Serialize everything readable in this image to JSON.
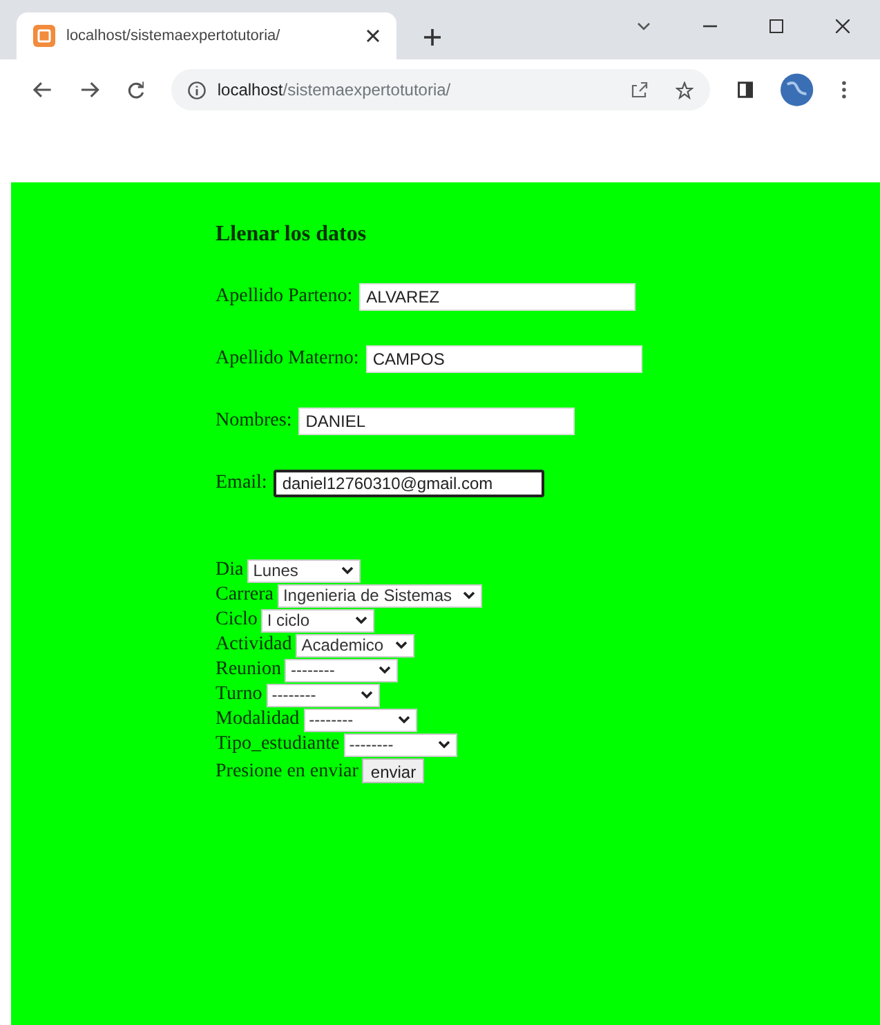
{
  "browser": {
    "tab": {
      "title": "localhost/sistemaexpertotutoria/"
    },
    "address": {
      "host": "localhost",
      "path": "/sistemaexpertotutoria/"
    }
  },
  "form": {
    "heading": "Llenar los datos",
    "fields": [
      {
        "label": "Apellido Parteno:",
        "value": "ALVAREZ",
        "focused": false
      },
      {
        "label": "Apellido Materno:",
        "value": "CAMPOS",
        "focused": false
      },
      {
        "label": "Nombres:",
        "value": "DANIEL",
        "focused": false
      },
      {
        "label": "Email:",
        "value": "daniel12760310@gmail.com",
        "focused": true
      }
    ],
    "selects": [
      {
        "label": "Dia",
        "value": "Lunes"
      },
      {
        "label": "Carrera",
        "value": "Ingenieria de Sistemas"
      },
      {
        "label": "Ciclo",
        "value": "I ciclo"
      },
      {
        "label": "Actividad",
        "value": "Academico"
      },
      {
        "label": "Reunion",
        "value": "--------"
      },
      {
        "label": "Turno",
        "value": "--------"
      },
      {
        "label": "Modalidad",
        "value": "--------"
      },
      {
        "label": "Tipo_estudiante",
        "value": "--------"
      }
    ],
    "submit": {
      "label": "Presione en enviar",
      "button": "enviar"
    }
  }
}
